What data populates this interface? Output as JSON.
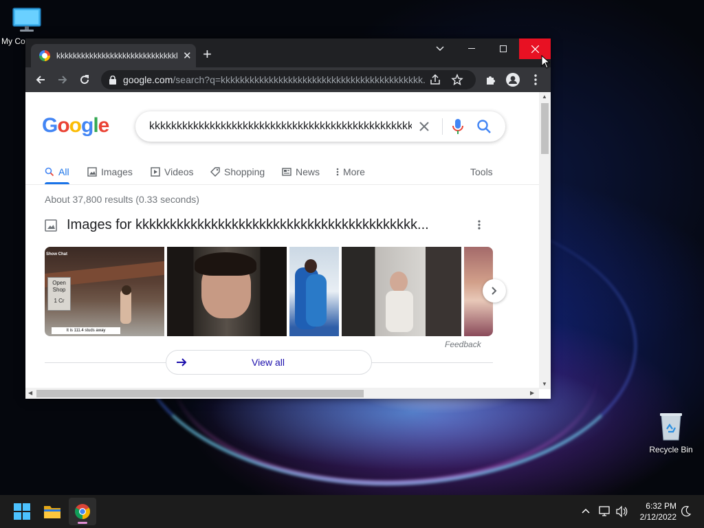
{
  "desktop": {
    "icons": [
      {
        "label": "My Co"
      },
      {
        "label": "Recycle Bin"
      }
    ]
  },
  "browser": {
    "tab_title": "kkkkkkkkkkkkkkkkkkkkkkkkkkkkkkkkkkkkkkkkkkkkk",
    "omnibox": {
      "host": "google.com",
      "path": "/search?q=kkkkkkkkkkkkkkkkkkkkkkkkkkkkkkkkkkkkkkkkkk..."
    }
  },
  "google": {
    "logo": [
      "G",
      "o",
      "o",
      "g",
      "l",
      "e"
    ],
    "query": "kkkkkkkkkkkkkkkkkkkkkkkkkkkkkkkkkkkkkkkkkkkkkkkkkk",
    "tabs": {
      "all": "All",
      "images": "Images",
      "videos": "Videos",
      "shopping": "Shopping",
      "news": "News",
      "more": "More",
      "tools": "Tools"
    },
    "result_stats": "About 37,800 results (0.33 seconds)",
    "images_heading": "Images for kkkkkkkkkkkkkkkkkkkkkkkkkkkkkkkkkkkkkkkkk...",
    "thumb1_text": {
      "show_chat": "Show Chat",
      "open_shop": "Open Shop",
      "cr": "1 Cr",
      "studs": "It is 111.4 studs away"
    },
    "feedback": "Feedback",
    "view_all": "View all"
  },
  "taskbar": {
    "time": "6:32 PM",
    "date": "2/12/2022"
  },
  "colors": {
    "accent_blue": "#1a73e8",
    "close_red": "#e81123",
    "chrome_dark": "#202124"
  }
}
